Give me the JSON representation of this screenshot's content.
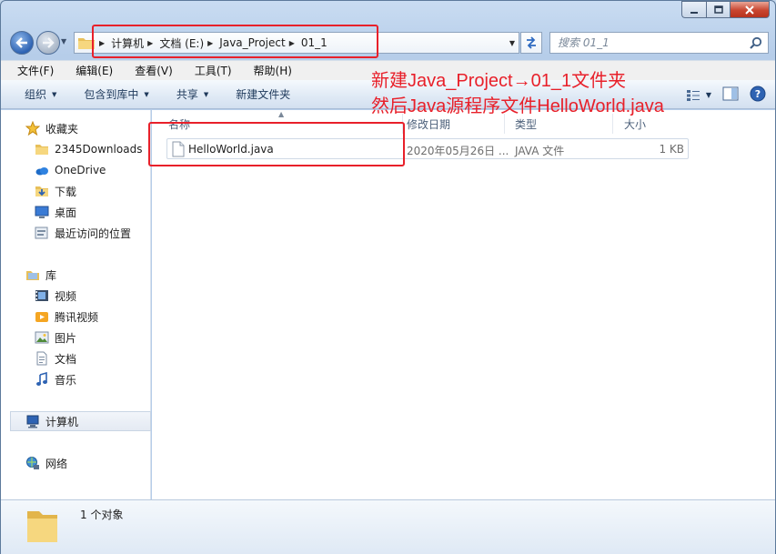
{
  "window": {
    "caption_buttons": [
      "minimize",
      "maximize",
      "close"
    ]
  },
  "address_bar": {
    "crumbs": [
      "计算机",
      "文档 (E:)",
      "Java_Project",
      "01_1"
    ]
  },
  "search": {
    "placeholder": "搜索 01_1"
  },
  "menu": {
    "items": [
      "文件(F)",
      "编辑(E)",
      "查看(V)",
      "工具(T)",
      "帮助(H)"
    ]
  },
  "toolbar": {
    "organize": "组织",
    "include_in_library": "包含到库中",
    "share": "共享",
    "new_folder": "新建文件夹"
  },
  "nav_pane": {
    "favorites_header": "收藏夹",
    "favorites": [
      "2345Downloads",
      "OneDrive",
      "下载",
      "桌面",
      "最近访问的位置"
    ],
    "libraries_header": "库",
    "libraries": [
      "视频",
      "腾讯视频",
      "图片",
      "文档",
      "音乐"
    ],
    "computer": "计算机",
    "network": "网络"
  },
  "columns": {
    "name": "名称",
    "modified": "修改日期",
    "type": "类型",
    "size": "大小"
  },
  "files": [
    {
      "name": "HelloWorld.java",
      "modified": "2020年05月26日 ...",
      "type": "JAVA 文件",
      "size": "1 KB"
    }
  ],
  "annotation": {
    "line1": "新建Java_Project→01_1文件夹",
    "line2": "然后Java源程序文件HelloWorld.java",
    "color": "#e8202a"
  },
  "status": {
    "item_count": "1 个对象"
  },
  "colors": {
    "accent": "#2e63b3",
    "frame": "#c4d7ec"
  }
}
